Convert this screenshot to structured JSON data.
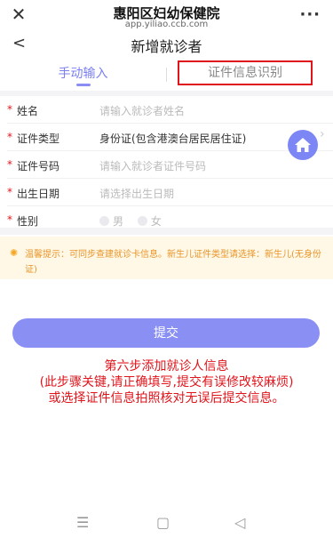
{
  "browser": {
    "close_glyph": "✕",
    "title": "惠阳区妇幼保健院",
    "url": "app.yiliao.ccb.com",
    "more_glyph": "···"
  },
  "nav": {
    "back_glyph": "<",
    "title": "新增就诊者"
  },
  "tabs": {
    "manual": "手动输入",
    "ocr": "证件信息识别"
  },
  "form": {
    "required_mark": "*",
    "name": {
      "label": "姓名",
      "placeholder": "请输入就诊者姓名"
    },
    "id_type": {
      "label": "证件类型",
      "value": "身份证(包含港澳台居民居住证)"
    },
    "id_number": {
      "label": "证件号码",
      "placeholder": "请输入就诊者证件号码"
    },
    "birth_date": {
      "label": "出生日期",
      "placeholder": "请选择出生日期"
    },
    "gender": {
      "label": "性别",
      "options": [
        "男",
        "女"
      ]
    }
  },
  "tip": {
    "icon": "lightbulb-icon",
    "text": "温馨提示：可同步查建就诊卡信息。新生儿证件类型请选择：新生儿(无身份证)"
  },
  "submit": {
    "label": "提交"
  },
  "annotation": {
    "line1": "第六步添加就诊人信息",
    "line2": "(此步骤关键,请正确填写,提交有误修改较麻烦)",
    "line3": "或选择证件信息拍照核对无误后提交信息。"
  },
  "system_nav": {
    "menu_glyph": "☰",
    "home_glyph": "▢",
    "back_glyph": "◁"
  },
  "colors": {
    "accent": "#8a90f3",
    "required": "#e0141b",
    "tip_bg": "#fff8e6",
    "tip_text": "#e8952a"
  }
}
